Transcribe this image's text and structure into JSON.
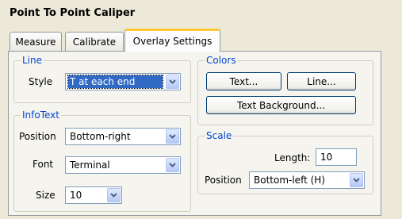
{
  "window": {
    "title": "Point To Point Caliper"
  },
  "tabs": [
    {
      "label": "Measure"
    },
    {
      "label": "Calibrate"
    },
    {
      "label": "Overlay Settings"
    }
  ],
  "line_group": {
    "legend": "Line",
    "style_label": "Style",
    "style_value": "T at each end"
  },
  "infotext_group": {
    "legend": "InfoText",
    "position_label": "Position",
    "position_value": "Bottom-right",
    "font_label": "Font",
    "font_value": "Terminal",
    "size_label": "Size",
    "size_value": "10"
  },
  "colors_group": {
    "legend": "Colors",
    "text_button": "Text...",
    "line_button": "Line...",
    "background_button": "Text Background..."
  },
  "scale_group": {
    "legend": "Scale",
    "length_label": "Length:",
    "length_value": "10",
    "position_label": "Position",
    "position_value": "Bottom-left (H)"
  },
  "colors": {
    "accent_tab": "#ffc83c",
    "legend_text": "#0046d5",
    "selection": "#316ac5"
  }
}
